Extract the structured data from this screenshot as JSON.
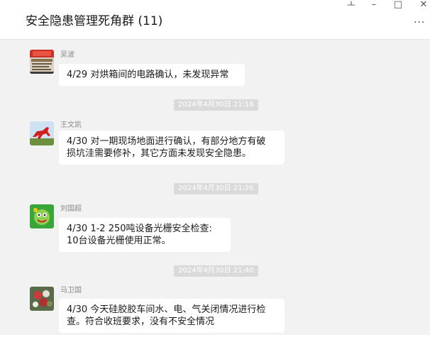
{
  "header": {
    "title": "安全隐患管理死角群 (11)",
    "controls": {
      "pin": "ㅗ",
      "minimize": "–",
      "maximize": "□",
      "close": "✕"
    },
    "more": "···"
  },
  "messages": [
    {
      "sender": "吴波",
      "lines": [
        "4/29 对烘箱间的电路确认，未发现异常"
      ],
      "avatar_icon": "poster-avatar"
    },
    {
      "timestamp": "2024年4月30日 21:18"
    },
    {
      "sender": "王文凯",
      "lines": [
        "4/30 对一期现场地面进行确认，有部分地方有破",
        "损坑洼需要修补，其它方面未发现安全隐患。"
      ],
      "avatar_icon": "red-horse-avatar"
    },
    {
      "timestamp": "2024年4月30日 21:26"
    },
    {
      "sender": "刘国超",
      "lines": [
        "4/30 1-2 250吨设备光栅安全检查:",
        "10台设备光栅使用正常。"
      ],
      "avatar_icon": "green-cartoon-avatar"
    },
    {
      "timestamp": "2024年4月30日 21:40"
    },
    {
      "sender": "马卫国",
      "lines": [
        "4/30 今天硅胶胶车间水、电、气关闭情况进行检",
        "查。符合收班要求，没有不安全情况"
      ],
      "avatar_icon": "flower-avatar"
    }
  ]
}
